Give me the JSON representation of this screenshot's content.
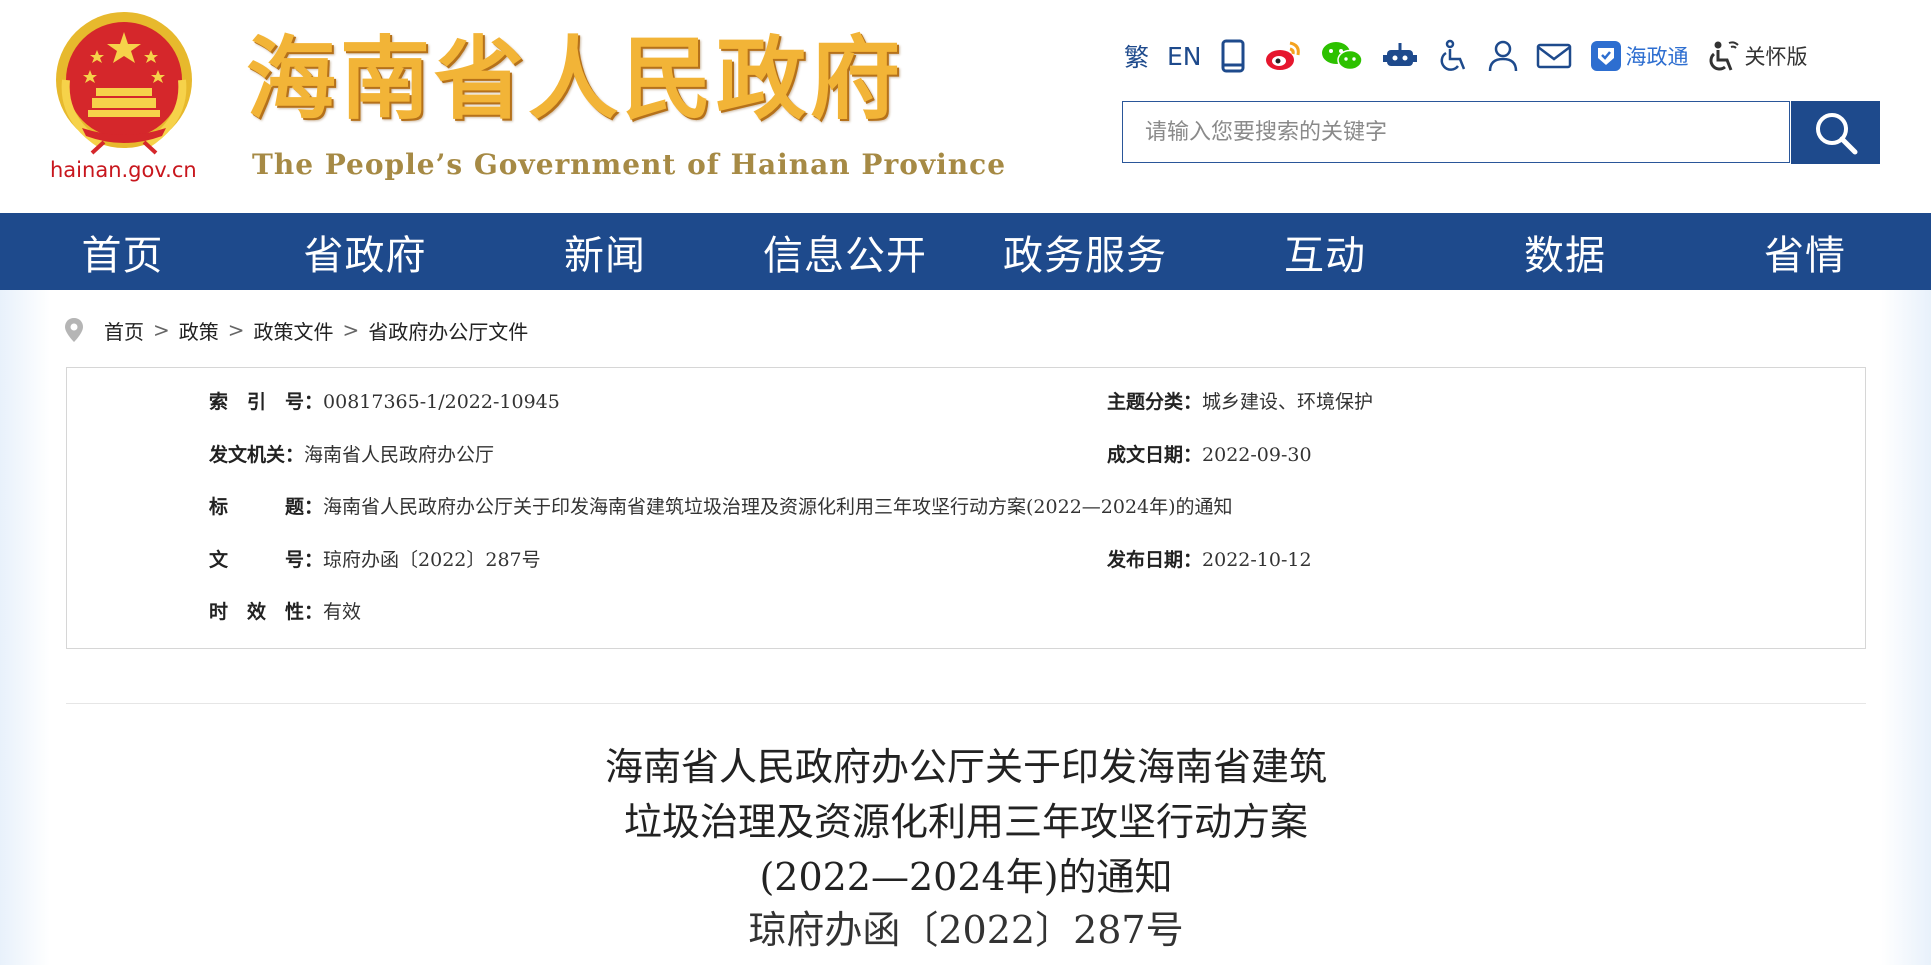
{
  "header": {
    "emblem_domain": "hainan.gov.cn",
    "site_title": "海南省人民政府",
    "site_subtitle": "The People’s Government of Hainan Province",
    "traditional_label": "繁",
    "english_label": "EN",
    "hzt_label": "海政通",
    "care_label": "关怀版",
    "icons": [
      "mobile-icon",
      "weibo-icon",
      "wechat-icon",
      "robot-icon",
      "accessibility-icon",
      "user-icon",
      "mail-icon",
      "hzt-icon",
      "care-mode-icon"
    ],
    "search": {
      "placeholder": "请输入您要搜索的关键字",
      "value": ""
    },
    "colors": {
      "title_gold": "#f2b437",
      "brand_blue": "#1e4a8c",
      "emblem_red": "#c8161d"
    }
  },
  "nav": {
    "items": [
      "首页",
      "省政府",
      "新闻",
      "信息公开",
      "政务服务",
      "互动",
      "数据",
      "省情"
    ]
  },
  "breadcrumb": [
    "首页",
    "政策",
    "政策文件",
    "省政府办公厅文件"
  ],
  "meta": {
    "index_no": {
      "label": "索引号",
      "value": "00817365-1/2022-10945"
    },
    "topic": {
      "label": "主题分类",
      "value": "城乡建设、环境保护"
    },
    "issuer": {
      "label": "发文机关",
      "value": "海南省人民政府办公厅"
    },
    "created_date": {
      "label": "成文日期",
      "value": "2022-09-30"
    },
    "title": {
      "label": "标题",
      "value": "海南省人民政府办公厅关于印发海南省建筑垃圾治理及资源化利用三年攻坚行动方案(2022—2024年)的通知"
    },
    "doc_no": {
      "label": "文号",
      "value": "琼府办函〔2022〕287号"
    },
    "published_date": {
      "label": "发布日期",
      "value": "2022-10-12"
    },
    "validity": {
      "label": "时效性",
      "value": "有效"
    },
    "colon": "："
  },
  "document": {
    "title_lines": [
      "海南省人民政府办公厅关于印发海南省建筑",
      "垃圾治理及资源化利用三年攻坚行动方案",
      "(2022—2024年)的通知"
    ],
    "number": "琼府办函〔2022〕287号"
  }
}
